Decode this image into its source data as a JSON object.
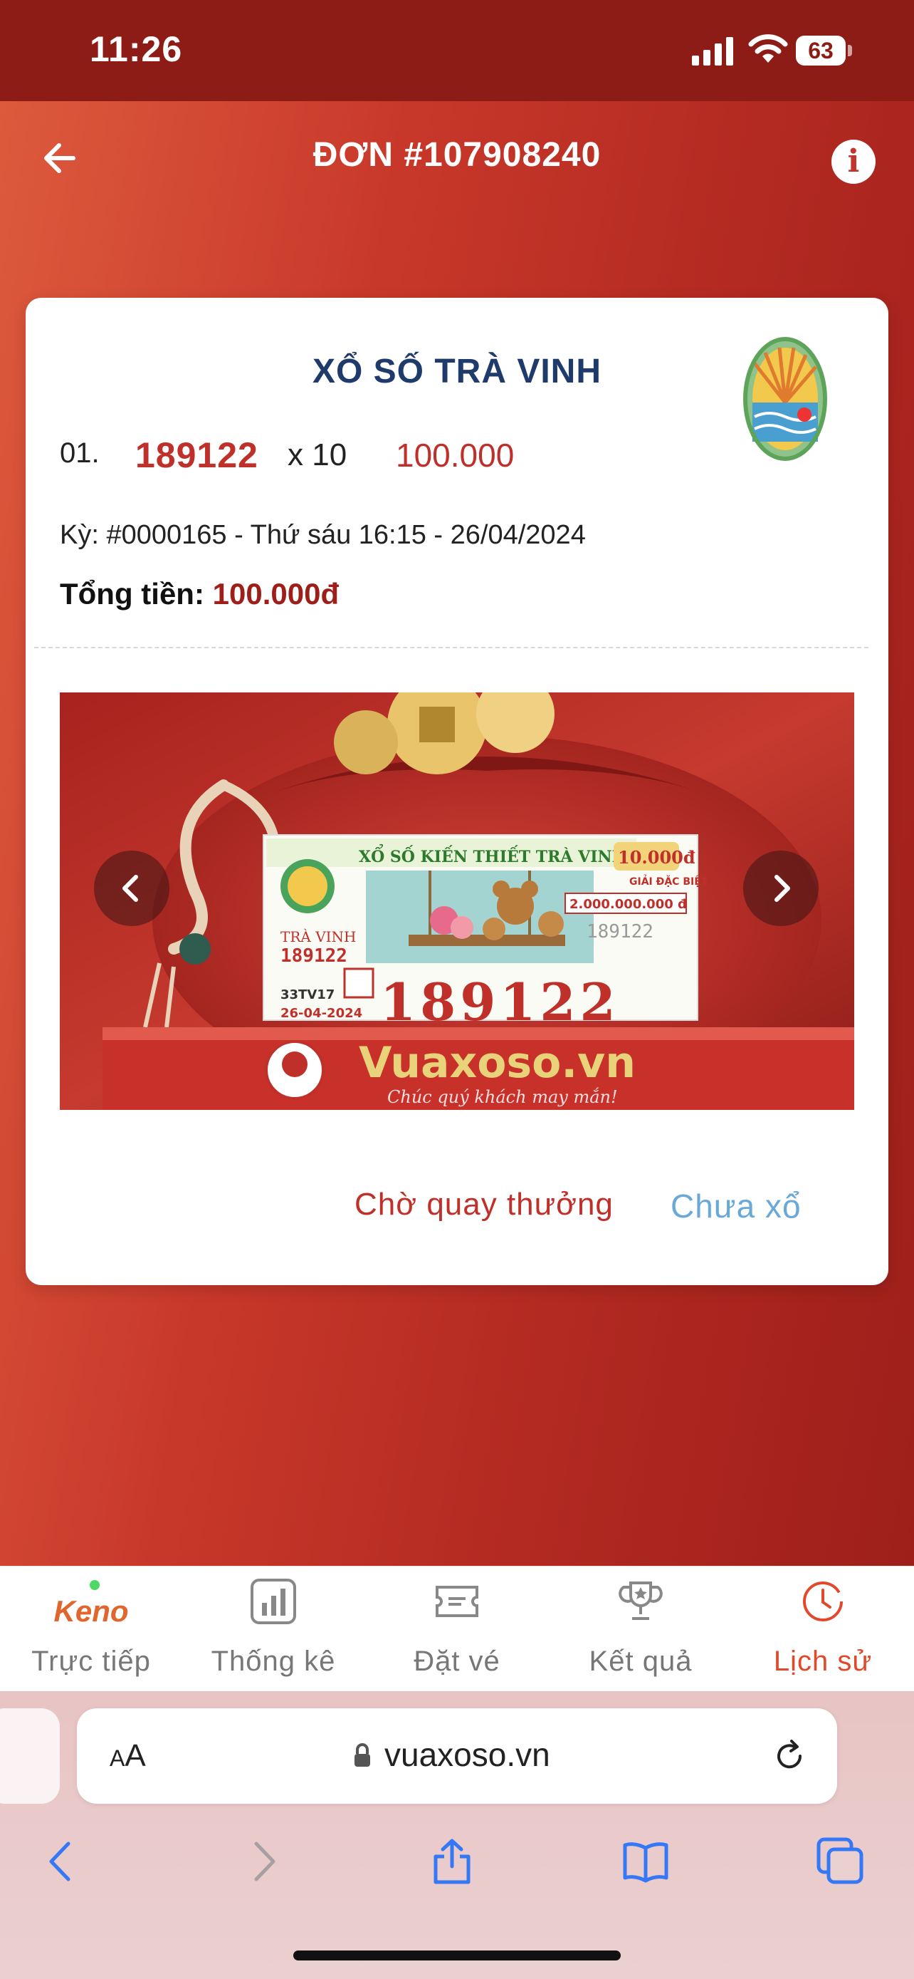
{
  "status_bar": {
    "time": "11:26",
    "battery": "63"
  },
  "header": {
    "title": "ĐƠN #107908240"
  },
  "card": {
    "lottery_name": "XỔ SỐ TRÀ VINH",
    "row": {
      "index": "01.",
      "number": "189122",
      "qty": "x 10",
      "amount": "100.000"
    },
    "period": "Kỳ: #0000165 - Thứ sáu 16:15 - 26/04/2024",
    "total_label": "Tổng tiền: ",
    "total_value": "100.000đ",
    "ticket_photo": {
      "ticket_header": "XỔ SỐ KIẾN THIẾT TRÀ VINH",
      "price": "10.000đ",
      "prize_label": "GIẢI ĐẶC BIỆT",
      "prize_amount": "2.000.000.000 đ",
      "province": "TRÀ VINH",
      "ticket_number": "189122",
      "series": "33TV17",
      "draw_date": "26-04-2024",
      "brand": "Vuaxoso.vn",
      "slogan": "Chúc quý khách may mắn!"
    },
    "status_waiting": "Chờ quay thưởng",
    "status_result": "Chưa xổ"
  },
  "tabbar": {
    "items": [
      {
        "top": "Keno",
        "label": "Trực tiếp"
      },
      {
        "label": "Thống kê"
      },
      {
        "label": "Đặt vé"
      },
      {
        "label": "Kết quả"
      },
      {
        "label": "Lịch sử"
      }
    ],
    "active_color": "#e04a2a"
  },
  "browser": {
    "aa": "AA",
    "url": "vuaxoso.vn"
  },
  "colors": {
    "status_bar": "#8e1c16",
    "accent_red": "#c0302a",
    "title_navy": "#1f3b6b",
    "link_blue": "#6aa8d8"
  }
}
